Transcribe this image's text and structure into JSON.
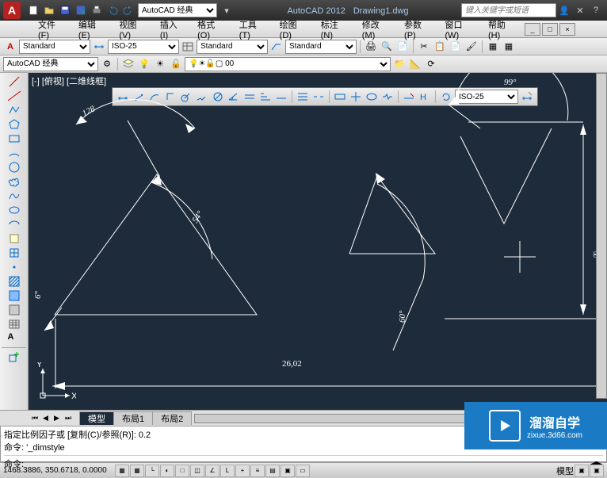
{
  "app": {
    "title": "AutoCAD 2012",
    "document": "Drawing1.dwg",
    "search_placeholder": "键入关键字或短语"
  },
  "qat": {
    "workspace": "AutoCAD 经典"
  },
  "menu": {
    "items": [
      "文件(F)",
      "编辑(E)",
      "视图(V)",
      "插入(I)",
      "格式(O)",
      "工具(T)",
      "绘图(D)",
      "标注(N)",
      "修改(M)",
      "参数(P)",
      "窗口(W)",
      "帮助(H)"
    ]
  },
  "toolbar1": {
    "style1": "Standard",
    "style2": "ISO-25",
    "style3": "Standard",
    "style4": "Standard"
  },
  "toolbar2": {
    "workspace": "AutoCAD 经典",
    "layer": "0"
  },
  "drawing": {
    "view_label": "[-] [俯视] [二维线框]",
    "float_dimstyle": "ISO-25",
    "annotations": {
      "a128": "128",
      "a54": "54°",
      "a60": "60°",
      "a99": "99°",
      "inf": "∞",
      "len": "26,02"
    }
  },
  "tabs": {
    "items": [
      "模型",
      "布局1",
      "布局2"
    ],
    "active": 0
  },
  "command": {
    "history1": "指定比例因子或 [复制(C)/参照(R)]: 0.2",
    "history2": "命令: '_dimstyle",
    "prompt": "命令:"
  },
  "status": {
    "coords": "1468.3886, 350.6718, 0.0000",
    "right": "模型"
  },
  "watermark": {
    "line1": "溜溜自学",
    "line2": "zixue.3d66.com"
  }
}
